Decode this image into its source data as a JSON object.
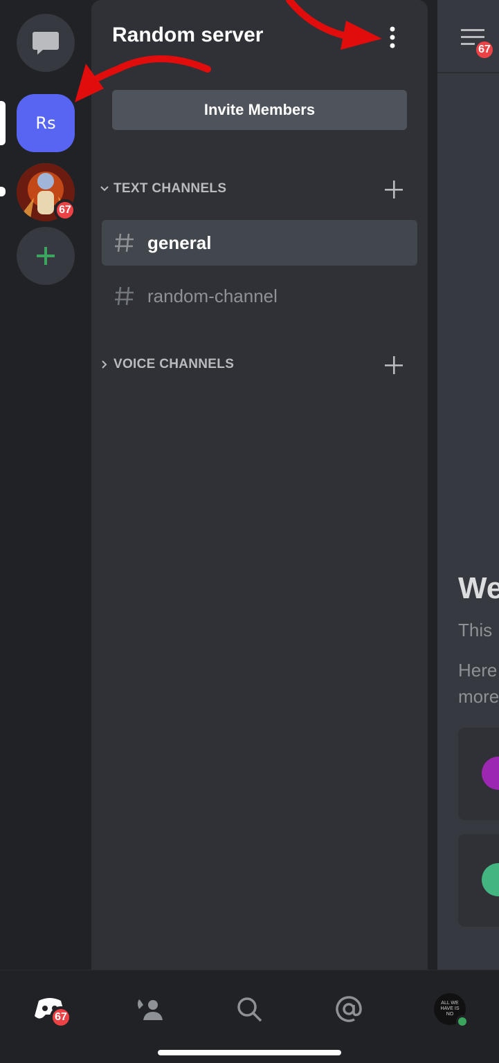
{
  "server": {
    "name": "Random server",
    "invite_label": "Invite Members"
  },
  "guilds": [
    {
      "id": "dm",
      "icon": "chat-bubble-icon"
    },
    {
      "id": "rs",
      "label": "Rs",
      "active": true
    },
    {
      "id": "avatar",
      "badge": "67"
    },
    {
      "id": "add",
      "icon": "plus-icon"
    }
  ],
  "categories": [
    {
      "label": "TEXT CHANNELS",
      "expanded": true
    },
    {
      "label": "VOICE CHANNELS",
      "expanded": false
    }
  ],
  "channels": [
    {
      "name": "general",
      "active": true
    },
    {
      "name": "random-channel",
      "active": false
    }
  ],
  "chat": {
    "menu_badge": "67",
    "welcome_title": "We",
    "welcome_sub": "This",
    "welcome_body_1": "Here",
    "welcome_body_2": "more"
  },
  "bottom_nav": {
    "home_badge": "67",
    "items": [
      "home-icon",
      "friends-icon",
      "search-icon",
      "mentions-icon",
      "profile-avatar"
    ],
    "avatar_text": "ALL WE HAVE IS NO"
  },
  "colors": {
    "blurple": "#5865f2",
    "danger": "#ed4245",
    "green": "#3ba55d",
    "panel": "#2f3136",
    "annotation_arrow": "#e10d0d"
  }
}
